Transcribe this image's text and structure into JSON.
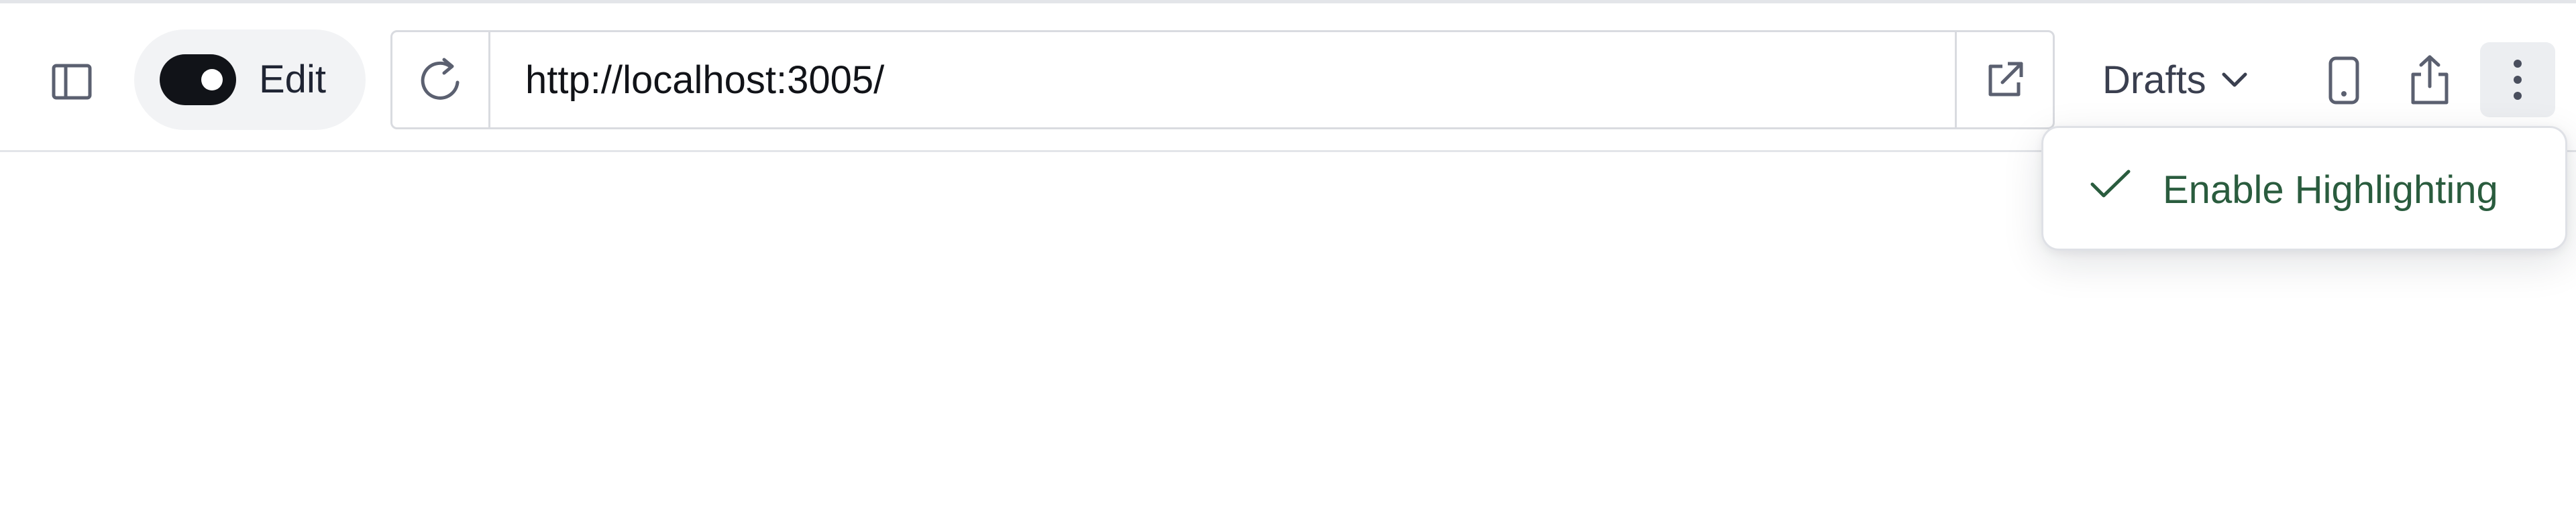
{
  "toolbar": {
    "edit_toggle": {
      "label": "Edit",
      "on": true
    },
    "url": {
      "value": "http://localhost:3005/"
    },
    "drafts": {
      "label": "Drafts"
    }
  },
  "menu": {
    "items": [
      {
        "label": "Enable Highlighting",
        "checked": true
      }
    ]
  },
  "icons": {
    "sidebar": "sidebar-panel-icon",
    "reload": "reload-icon",
    "external": "external-link-icon",
    "chevron": "chevron-down-icon",
    "device": "mobile-device-icon",
    "share": "share-icon",
    "more": "more-vertical-icon",
    "check": "checkmark-icon"
  },
  "colors": {
    "toggle_on": "#111318",
    "menu_accent": "#2a5c3e",
    "border": "#d9dbe0"
  }
}
